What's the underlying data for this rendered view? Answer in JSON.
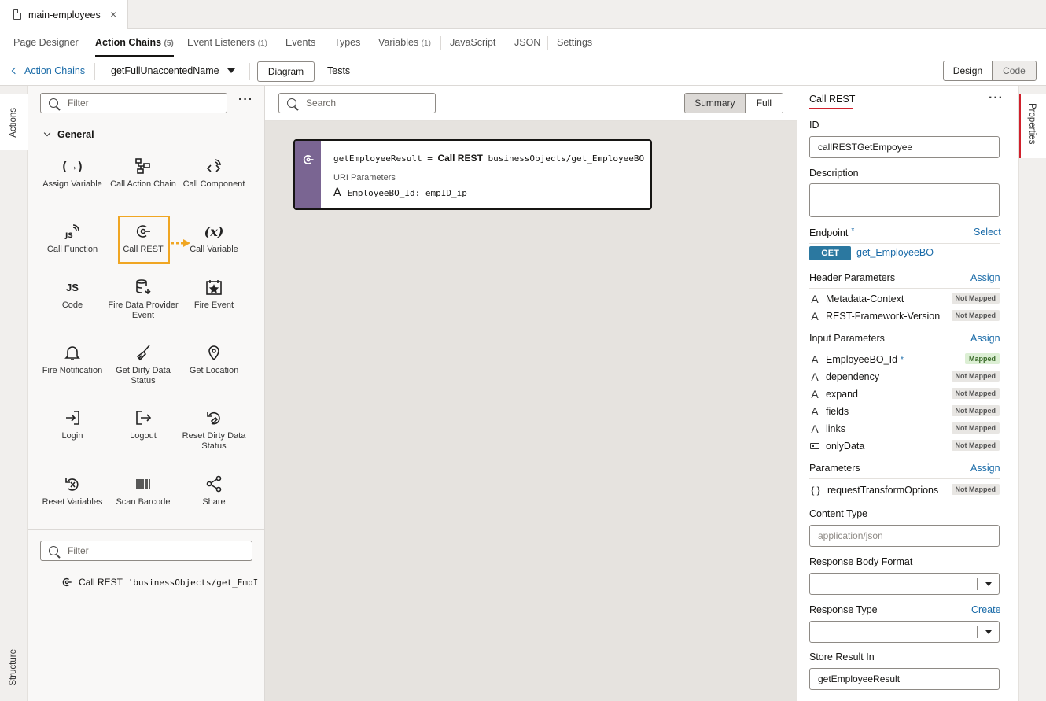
{
  "file_tab": {
    "label": "main-employees",
    "close": "×"
  },
  "nav_tabs": [
    {
      "label": "Page Designer",
      "count": ""
    },
    {
      "label": "Action Chains",
      "count": "(5)"
    },
    {
      "label": "Event Listeners",
      "count": "(1)"
    },
    {
      "label": "Events",
      "count": ""
    },
    {
      "label": "Types",
      "count": ""
    },
    {
      "label": "Variables",
      "count": "(1)"
    },
    {
      "label": "JavaScript",
      "count": ""
    },
    {
      "label": "JSON",
      "count": ""
    },
    {
      "label": "Settings",
      "count": ""
    }
  ],
  "toolbar": {
    "back_label": "Action Chains",
    "chain_name": "getFullUnaccentedName",
    "diagram_label": "Diagram",
    "tests_label": "Tests",
    "design_label": "Design",
    "code_label": "Code"
  },
  "rails": {
    "actions": "Actions",
    "structure": "Structure",
    "properties": "Properties"
  },
  "actions_panel": {
    "filter_placeholder": "Filter",
    "more": "···",
    "section": "General",
    "items": [
      {
        "label": "Assign Variable",
        "icon": "assign-variable-icon"
      },
      {
        "label": "Call Action Chain",
        "icon": "call-action-chain-icon"
      },
      {
        "label": "Call Component",
        "icon": "call-component-icon"
      },
      {
        "label": "Call Function",
        "icon": "call-function-icon"
      },
      {
        "label": "Call REST",
        "icon": "call-rest-icon"
      },
      {
        "label": "Call Variable",
        "icon": "call-variable-icon"
      },
      {
        "label": "Code",
        "icon": "code-icon"
      },
      {
        "label": "Fire Data Provider Event",
        "icon": "fire-data-provider-event-icon"
      },
      {
        "label": "Fire Event",
        "icon": "fire-event-icon"
      },
      {
        "label": "Fire Notification",
        "icon": "bell-icon"
      },
      {
        "label": "Get Dirty Data Status",
        "icon": "broom-icon"
      },
      {
        "label": "Get Location",
        "icon": "location-pin-icon"
      },
      {
        "label": "Login",
        "icon": "login-icon"
      },
      {
        "label": "Logout",
        "icon": "logout-icon"
      },
      {
        "label": "Reset Dirty Data Status",
        "icon": "reset-dirty-icon"
      },
      {
        "label": "Reset Variables",
        "icon": "reset-variables-icon"
      },
      {
        "label": "Scan Barcode",
        "icon": "barcode-icon"
      },
      {
        "label": "Share",
        "icon": "share-icon"
      }
    ]
  },
  "structure_panel": {
    "filter_placeholder": "Filter",
    "item": "Call REST",
    "item_detail": "'businessObjects/get_EmpI"
  },
  "canvas": {
    "search_placeholder": "Search",
    "summary_label": "Summary",
    "full_label": "Full",
    "node": {
      "result_var": "getEmployeeResult",
      "equals": "=",
      "action": "Call REST",
      "endpoint": "businessObjects/get_EmployeeBO",
      "section": "URI Parameters",
      "param": "EmployeeBO_Id: empID_ip"
    }
  },
  "properties": {
    "title": "Call REST",
    "more": "···",
    "id_label": "ID",
    "id_value": "callRESTGetEmpoyee",
    "description_label": "Description",
    "endpoint_label": "Endpoint",
    "required_mark": "*",
    "select_link": "Select",
    "method": "GET",
    "endpoint_value": "get_EmployeeBO",
    "header_params_label": "Header Parameters",
    "assign_link": "Assign",
    "header_params": [
      {
        "name": "Metadata-Context",
        "status": "Not Mapped"
      },
      {
        "name": "REST-Framework-Version",
        "status": "Not Mapped"
      }
    ],
    "input_params_label": "Input Parameters",
    "input_params": [
      {
        "name": "EmployeeBO_Id",
        "status": "Mapped",
        "required": true
      },
      {
        "name": "dependency",
        "status": "Not Mapped"
      },
      {
        "name": "expand",
        "status": "Not Mapped"
      },
      {
        "name": "fields",
        "status": "Not Mapped"
      },
      {
        "name": "links",
        "status": "Not Mapped"
      },
      {
        "name": "onlyData",
        "status": "Not Mapped"
      }
    ],
    "parameters_label": "Parameters",
    "parameters": [
      {
        "name": "requestTransformOptions",
        "status": "Not Mapped"
      }
    ],
    "content_type_label": "Content Type",
    "content_type_placeholder": "application/json",
    "response_body_label": "Response Body Format",
    "response_type_label": "Response Type",
    "create_link": "Create",
    "store_result_label": "Store Result In",
    "store_result_value": "getEmployeeResult"
  },
  "colors": {
    "accent": "#1a6ba8",
    "highlight": "#f0a623",
    "node_stripe": "#7a6592",
    "get_badge": "#2b78a0"
  }
}
